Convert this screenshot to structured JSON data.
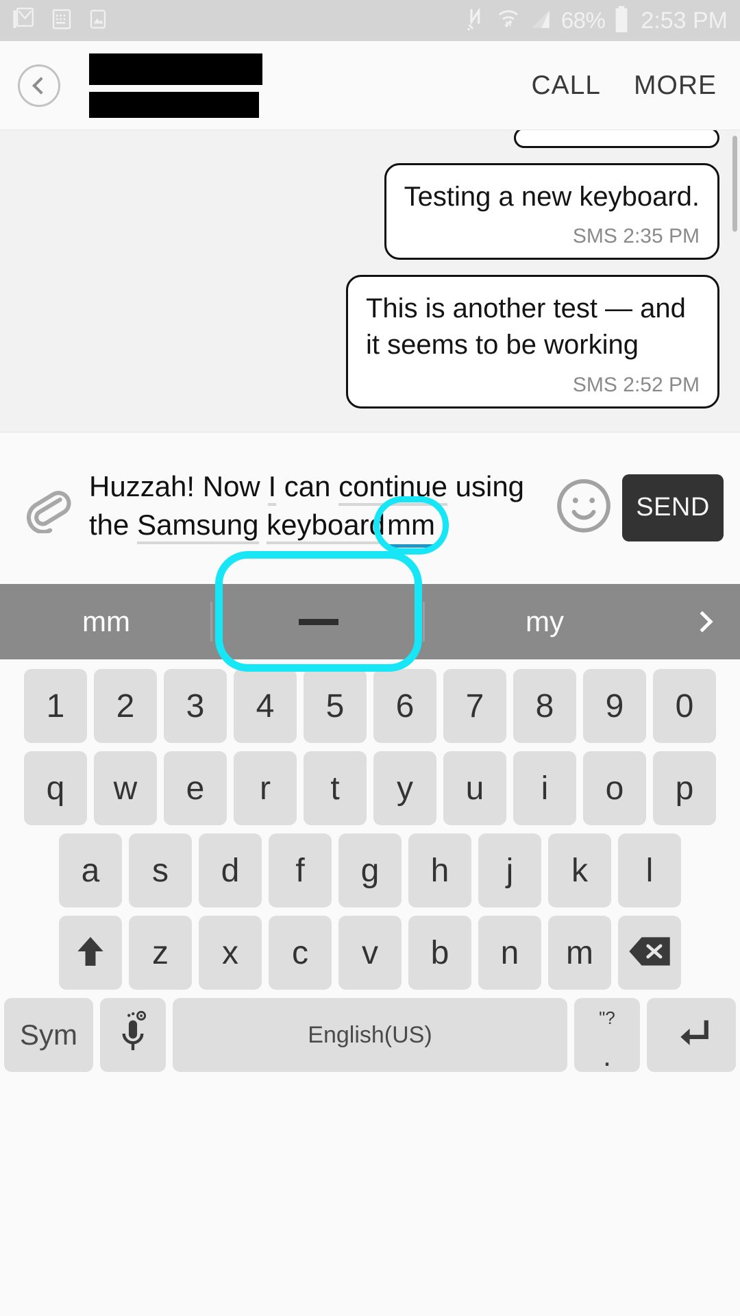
{
  "status_bar": {
    "icons_left": [
      "gmail-icon",
      "keyboard-icon",
      "screenshot-icon"
    ],
    "icons_right": [
      "nfc-icon",
      "wifi-icon",
      "signal-icon"
    ],
    "battery_percent": "68%",
    "clock": "2:53 PM",
    "bg_color": "#d4d4d4",
    "fg_color": "#f1f1f1"
  },
  "header": {
    "back_icon": "back-chevron-icon",
    "contact_name_redacted": true,
    "contact_number_redacted": true,
    "actions": [
      {
        "label": "CALL",
        "name": "call-button"
      },
      {
        "label": "MORE",
        "name": "more-button"
      }
    ]
  },
  "conversation": {
    "messages": [
      {
        "text": "",
        "meta": "",
        "clipped": true
      },
      {
        "text": "Testing a new keyboard.",
        "meta": "SMS 2:35 PM",
        "clipped": false
      },
      {
        "text": "This is another test — and it seems to be working",
        "meta": "SMS 2:52 PM",
        "clipped": false
      }
    ]
  },
  "compose": {
    "attach_icon": "paperclip-icon",
    "emoji_icon": "smiley-icon",
    "draft_segments": [
      {
        "text": "Huzzah! Now ",
        "style": "plain"
      },
      {
        "text": "I",
        "style": "underline"
      },
      {
        "text": " ",
        "style": "plain"
      },
      {
        "text": "continue",
        "style": "underline"
      },
      {
        "text": " using the ",
        "style": "plain"
      },
      {
        "text": "Samsung",
        "style": "underline"
      },
      {
        "text": " ",
        "style": "plain"
      },
      {
        "text": "keyboard",
        "style": "underline"
      },
      {
        "text": "mm",
        "style": "highlight"
      }
    ],
    "draft_full_text": "Huzzah! Now I can continue using the Samsung keyboard mm",
    "send_label": "SEND",
    "send_bg": "#333333",
    "highlight_color": "#16e6f5",
    "composing_underline_color": "#2196c4"
  },
  "suggestions": {
    "bg_color": "#8a8a8a",
    "items": [
      {
        "label": "mm",
        "highlighted": false,
        "name": "suggestion-mm"
      },
      {
        "label": "—",
        "highlighted": true,
        "name": "suggestion-emdash"
      },
      {
        "label": "my",
        "highlighted": false,
        "name": "suggestion-my"
      }
    ],
    "expand_icon": "chevron-right-icon"
  },
  "keyboard": {
    "rows": {
      "numbers": [
        "1",
        "2",
        "3",
        "4",
        "5",
        "6",
        "7",
        "8",
        "9",
        "0"
      ],
      "letters1": [
        "q",
        "w",
        "e",
        "r",
        "t",
        "y",
        "u",
        "i",
        "o",
        "p"
      ],
      "letters2": [
        "a",
        "s",
        "d",
        "f",
        "g",
        "h",
        "j",
        "k",
        "l"
      ],
      "letters3": [
        "z",
        "x",
        "c",
        "v",
        "b",
        "n",
        "m"
      ]
    },
    "shift_icon": "shift-arrow-icon",
    "backspace_icon": "backspace-icon",
    "sym_label": "Sym",
    "mic_icon": "microphone-settings-icon",
    "space_label": "English(US)",
    "punct_primary": ".",
    "punct_secondary": "\"?",
    "enter_icon": "enter-return-icon",
    "key_bg": "#dedede"
  }
}
